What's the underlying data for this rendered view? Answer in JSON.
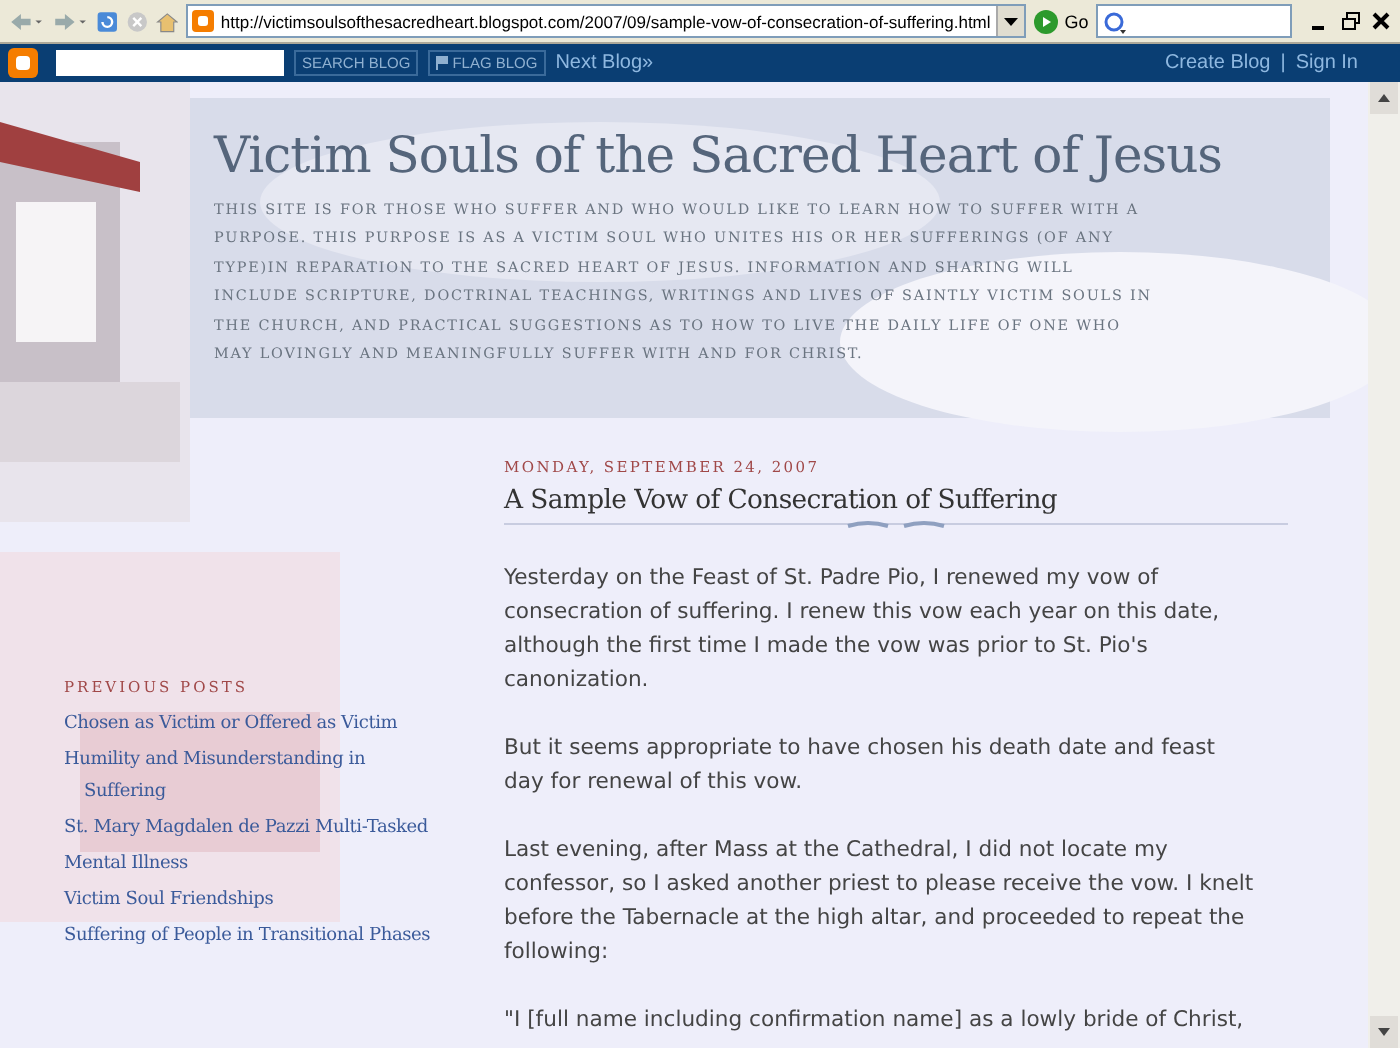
{
  "browser": {
    "address": "http://victimsoulsofthesacredheart.blogspot.com/2007/09/sample-vow-of-consecration-of-suffering.html",
    "go_label": "Go"
  },
  "navbar": {
    "search_button": "SEARCH BLOG",
    "flag_button": "FLAG BLOG",
    "next_blog": "Next Blog»",
    "create_blog": "Create Blog",
    "separator": "|",
    "sign_in": "Sign In"
  },
  "header": {
    "title": "Victim Souls of the Sacred Heart of Jesus",
    "description": "THIS SITE IS FOR THOSE WHO SUFFER AND WHO WOULD LIKE TO LEARN HOW TO SUFFER WITH A PURPOSE. THIS PURPOSE IS AS A VICTIM SOUL WHO UNITES HIS OR HER SUFFERINGS (OF ANY TYPE)IN REPARATION TO THE SACRED HEART OF JESUS. INFORMATION AND SHARING WILL INCLUDE SCRIPTURE, DOCTRINAL TEACHINGS, WRITINGS AND LIVES OF SAINTLY VICTIM SOULS IN THE CHURCH, AND PRACTICAL SUGGESTIONS AS TO HOW TO LIVE THE DAILY LIFE OF ONE WHO MAY LOVINGLY AND MEANINGFULLY SUFFER WITH AND FOR CHRIST."
  },
  "sidebar": {
    "heading": "PREVIOUS POSTS",
    "items": [
      {
        "label": "Chosen as Victim or Offered as Victim"
      },
      {
        "label": "Humility and Misunderstanding in Suffering"
      },
      {
        "label": "St. Mary Magdalen de Pazzi Multi-Tasked"
      },
      {
        "label": "Mental Illness"
      },
      {
        "label": "Victim Soul Friendships"
      },
      {
        "label": "Suffering of People in Transitional Phases"
      }
    ]
  },
  "post": {
    "date": "MONDAY, SEPTEMBER 24, 2007",
    "title": "A Sample Vow of Consecration of Suffering",
    "paragraphs": [
      "Yesterday on the Feast of St. Padre Pio, I renewed my vow of consecration of suffering. I renew this vow each year on this date, although the first time I made the vow was prior to St. Pio's canonization.",
      "But it seems appropriate to have chosen his death date and feast day for renewal of this vow.",
      "Last evening, after Mass at the Cathedral, I did not locate my confessor, so I asked another priest to please receive the vow. I knelt before the Tabernacle at the high altar, and proceeded to repeat the following:",
      "\"I [full name including confirmation name] as a lowly bride of Christ,"
    ]
  }
}
